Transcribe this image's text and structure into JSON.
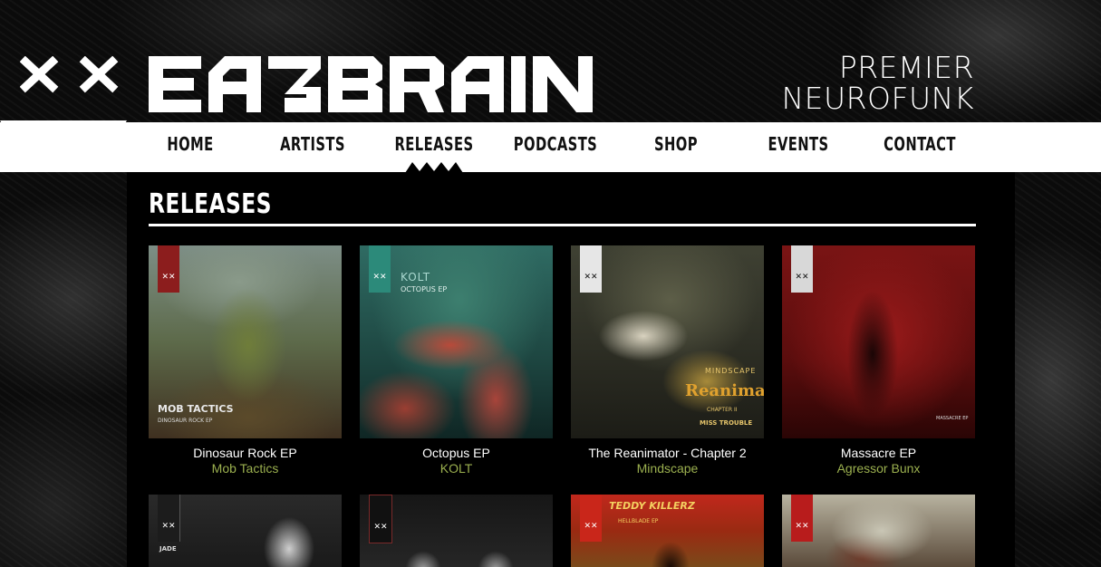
{
  "brand": {
    "name": "EATBRAIN",
    "tagline_line1": "PREMIER",
    "tagline_line2": "NEUROFUNK"
  },
  "nav": {
    "items": [
      {
        "label": "HOME"
      },
      {
        "label": "ARTISTS"
      },
      {
        "label": "RELEASES",
        "active": true
      },
      {
        "label": "PODCASTS"
      },
      {
        "label": "SHOP"
      },
      {
        "label": "EVENTS"
      },
      {
        "label": "CONTACT"
      }
    ]
  },
  "page": {
    "title": "RELEASES"
  },
  "releases": [
    {
      "title": "Dinosaur Rock EP",
      "artist": "Mob Tactics",
      "cover_text_1": "MOB TACTICS",
      "cover_text_2": "DINOSAUR ROCK EP"
    },
    {
      "title": "Octopus EP",
      "artist": "KOLT",
      "cover_text_1": "KOLT",
      "cover_text_2": "OCTOPUS EP"
    },
    {
      "title": "The Reanimator - Chapter 2",
      "artist": "Mindscape",
      "cover_text_1": "MINDSCAPE",
      "cover_text_2": "Reanimator",
      "cover_text_3": "CHAPTER II",
      "cover_text_4": "MISS TROUBLE"
    },
    {
      "title": "Massacre EP",
      "artist": "Agressor Bunx",
      "cover_text_1": "MASSACRE EP"
    }
  ],
  "releases_row2": [
    {
      "cover_text_1": "JADE"
    },
    {
      "cover_text_1": ""
    },
    {
      "cover_text_1": "TEDDY KILLERZ",
      "cover_text_2": "HELLBLADE EP"
    },
    {
      "cover_text_1": ""
    }
  ],
  "colors": {
    "accent_green": "#9bb04f",
    "nav_bg": "#ffffff",
    "page_bg": "#000000"
  }
}
